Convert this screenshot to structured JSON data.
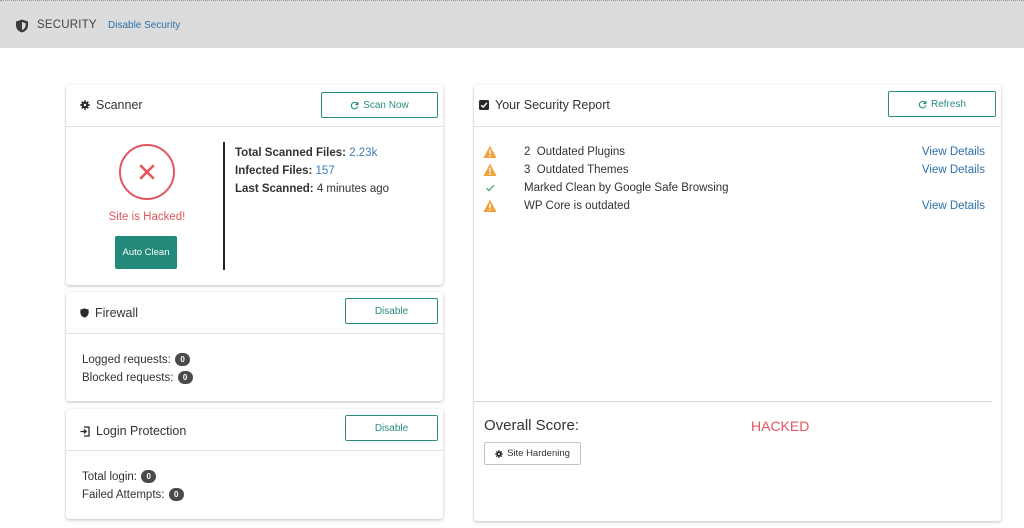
{
  "topbar": {
    "title": "SECURITY",
    "disable_link": "Disable Security"
  },
  "scanner": {
    "title": "Scanner",
    "scan_button": "Scan Now",
    "status_text": "Site is Hacked!",
    "auto_clean_button": "Auto Clean",
    "total_scanned_label": "Total Scanned Files:",
    "total_scanned_value": "2.23k",
    "infected_label": "Infected Files:",
    "infected_value": "157",
    "last_scanned_label": "Last Scanned:",
    "last_scanned_value": "4 minutes ago"
  },
  "firewall": {
    "title": "Firewall",
    "disable_button": "Disable",
    "logged_label": "Logged requests:",
    "logged_count": "0",
    "blocked_label": "Blocked requests:",
    "blocked_count": "0"
  },
  "login_protection": {
    "title": "Login Protection",
    "disable_button": "Disable",
    "total_label": "Total login:",
    "total_count": "0",
    "failed_label": "Failed Attempts:",
    "failed_count": "0"
  },
  "report": {
    "title": "Your Security Report",
    "refresh_button": "Refresh",
    "items": [
      {
        "icon": "warning-icon",
        "text": "2  Outdated Plugins",
        "action": "View Details"
      },
      {
        "icon": "warning-icon",
        "text": "3  Outdated Themes",
        "action": "View Details"
      },
      {
        "icon": "check-icon",
        "text": "Marked Clean by Google Safe Browsing",
        "action": ""
      },
      {
        "icon": "warning-icon",
        "text": "WP Core is outdated",
        "action": "View Details"
      }
    ],
    "score_label": "Overall Score:",
    "score_value": "HACKED",
    "hardening_button": "Site Hardening"
  },
  "colors": {
    "accent": "#22897b",
    "danger": "#e5555e",
    "warning": "#f0a23c",
    "link": "#2f6fa8",
    "success": "#3aaa5a"
  }
}
